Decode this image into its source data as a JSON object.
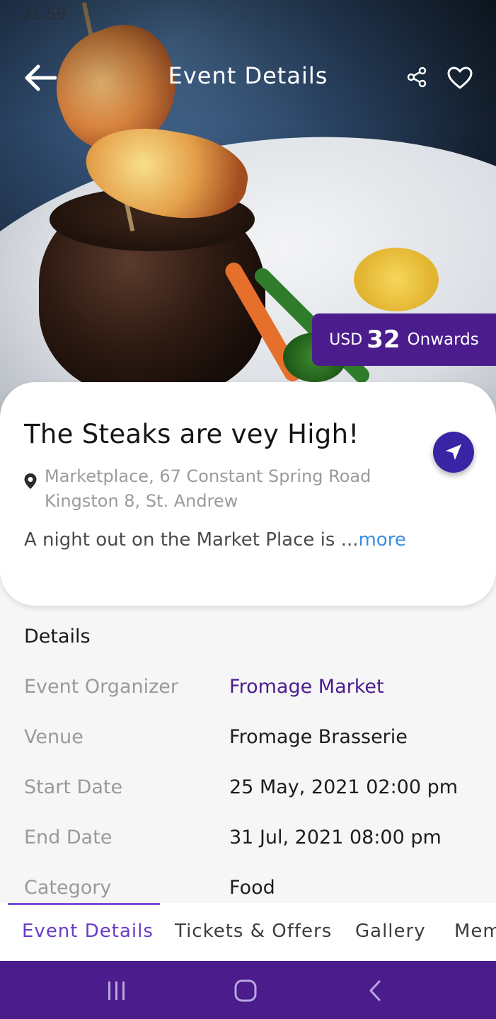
{
  "status_bar": {
    "time": "21:59"
  },
  "app_bar": {
    "title": "Event  Details",
    "back_icon": "arrow-left-icon",
    "share_icon": "share-icon",
    "favorite_icon": "heart-icon"
  },
  "price": {
    "currency": "USD",
    "amount": "32",
    "suffix": "Onwards"
  },
  "event": {
    "title": "The Steaks are vey High!",
    "address_line1": "Marketplace, 67 Constant Spring Road",
    "address_line2": "Kingston 8, St. Andrew",
    "description": "A night out on the Market Place is ...",
    "more_label": "more"
  },
  "details": {
    "heading": "Details",
    "rows": [
      {
        "label": "Event Organizer",
        "value": "Fromage Market"
      },
      {
        "label": "Venue",
        "value": "Fromage Brasserie"
      },
      {
        "label": "Start Date",
        "value": "25 May, 2021 02:00 pm"
      },
      {
        "label": "End Date",
        "value": "31 Jul, 2021 08:00 pm"
      },
      {
        "label": "Category",
        "value": "Food"
      }
    ]
  },
  "tabs": [
    {
      "label": "Event  Details"
    },
    {
      "label": "Tickets  &  Offers"
    },
    {
      "label": "Gallery"
    },
    {
      "label": "Members"
    }
  ],
  "colors": {
    "primary": "#4a1c8c",
    "accent": "#3a24a6",
    "link": "#3b8de0"
  }
}
